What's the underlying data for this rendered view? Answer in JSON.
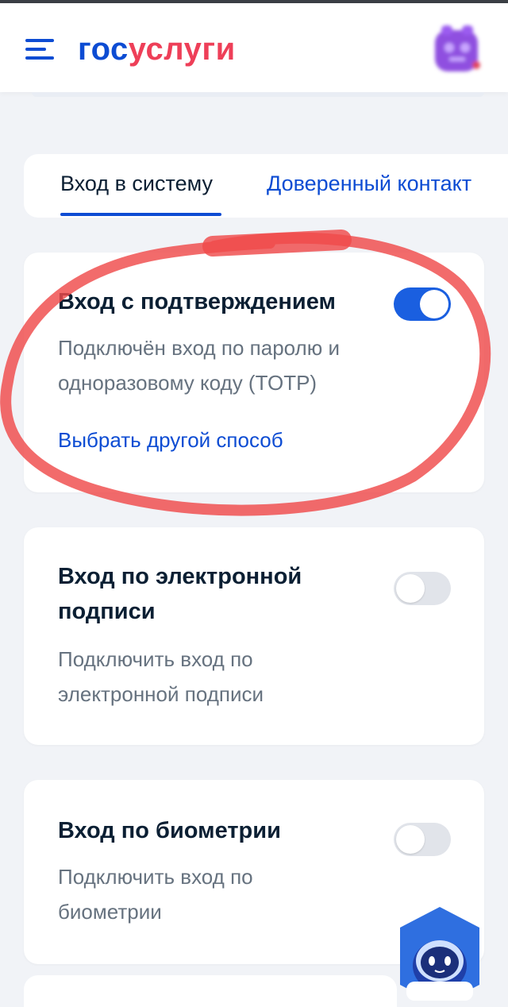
{
  "header": {
    "logo_part1": "гос",
    "logo_part2": "услуги",
    "brand_blue": "#0d4cd3",
    "brand_red": "#ee3f58",
    "menu_icon": "menu-icon",
    "avatar_icon": "avatar-icon"
  },
  "tabs": [
    {
      "label": "Вход в систему",
      "active": true
    },
    {
      "label": "Доверенный контакт",
      "active": false
    }
  ],
  "cards": [
    {
      "title": "Вход с подтверждением",
      "description_line1": "Подключён вход по паролю и",
      "description_line2": "одноразовому коду (TOTP)",
      "link": "Выбрать другой способ",
      "toggle_on": true
    },
    {
      "title_line1": "Вход по электронной",
      "title_line2": "подписи",
      "description_line1": "Подключить вход по",
      "description_line2": "электронной подписи",
      "toggle_on": false
    },
    {
      "title": "Вход по биометрии",
      "description_line1": "Подключить вход по",
      "description_line2": "биометрии",
      "toggle_on": false
    }
  ],
  "annotation_color": "#ef4a4a",
  "assistant_icon": "robot-assistant-icon"
}
